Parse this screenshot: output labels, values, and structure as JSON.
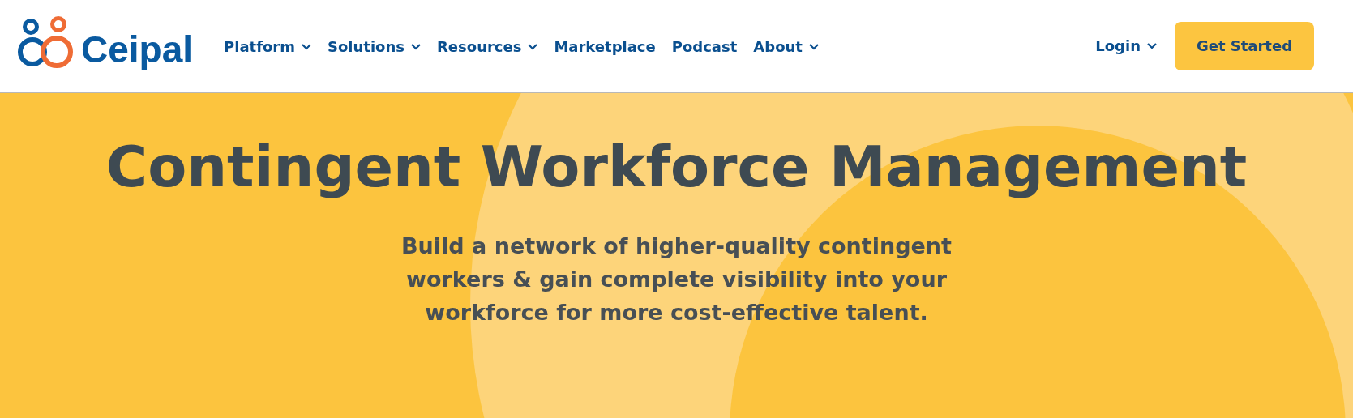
{
  "header": {
    "logo_text": "Ceipal",
    "nav": [
      {
        "label": "Platform",
        "has_menu": true
      },
      {
        "label": "Solutions",
        "has_menu": true
      },
      {
        "label": "Resources",
        "has_menu": true
      },
      {
        "label": "Marketplace",
        "has_menu": false
      },
      {
        "label": "Podcast",
        "has_menu": false
      },
      {
        "label": "About",
        "has_menu": true
      }
    ],
    "login": {
      "label": "Login",
      "has_menu": true
    },
    "cta": "Get Started"
  },
  "hero": {
    "title": "Contingent Workforce Management",
    "subtitle": "Build a network of higher-quality contingent workers & gain complete visibility into your workforce for more cost-effective talent."
  }
}
